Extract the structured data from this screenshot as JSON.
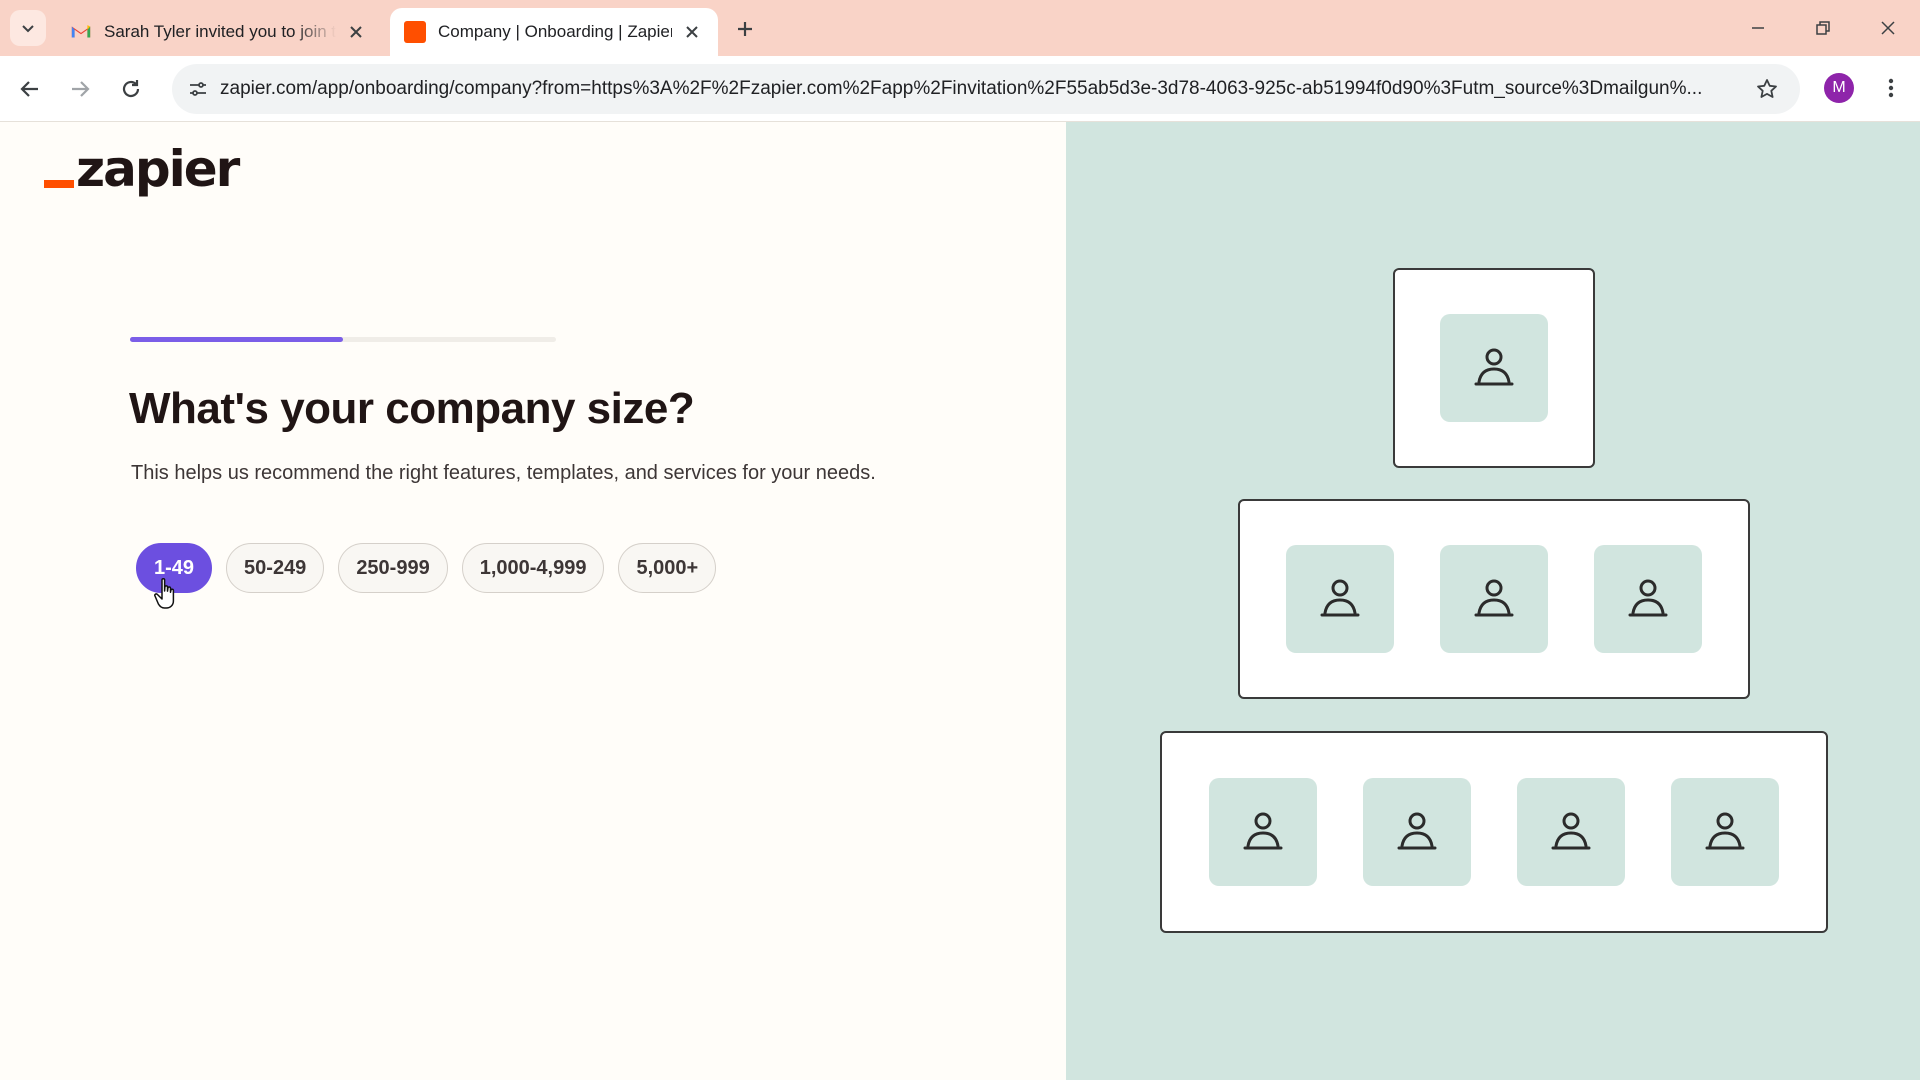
{
  "browser": {
    "tabs": [
      {
        "title": "Sarah Tyler invited you to join the",
        "favicon": "gmail-icon",
        "active": false
      },
      {
        "title": "Company | Onboarding | Zapier",
        "favicon": "zapier-favicon",
        "active": true
      }
    ],
    "url": "zapier.com/app/onboarding/company?from=https%3A%2F%2Fzapier.com%2Fapp%2Finvitation%2F55ab5d3e-3d78-4063-925c-ab51994f0d90%3Futm_source%3Dmailgun%...",
    "profile_initial": "M",
    "colors": {
      "tabbar": "#f9d3c7",
      "avatar": "#8e24aa"
    }
  },
  "page": {
    "logo_text": "zapier",
    "progress": 0.5,
    "heading": "What's your company size?",
    "subtext": "This helps us recommend the right features, templates, and services for your needs.",
    "options": [
      {
        "label": "1-49",
        "selected": true
      },
      {
        "label": "50-249",
        "selected": false
      },
      {
        "label": "250-999",
        "selected": false
      },
      {
        "label": "1,000-4,999",
        "selected": false
      },
      {
        "label": "5,000+",
        "selected": false
      }
    ],
    "colors": {
      "accent": "#6c4fe0",
      "brand": "#ff4f00",
      "illustration_bg": "#d1e5df"
    }
  },
  "illustration": {
    "tiers": [
      {
        "people": 1,
        "icon": "person-icon"
      },
      {
        "people": 3,
        "icon": "person-icon"
      },
      {
        "people": 4,
        "icon": "person-icon"
      }
    ]
  }
}
